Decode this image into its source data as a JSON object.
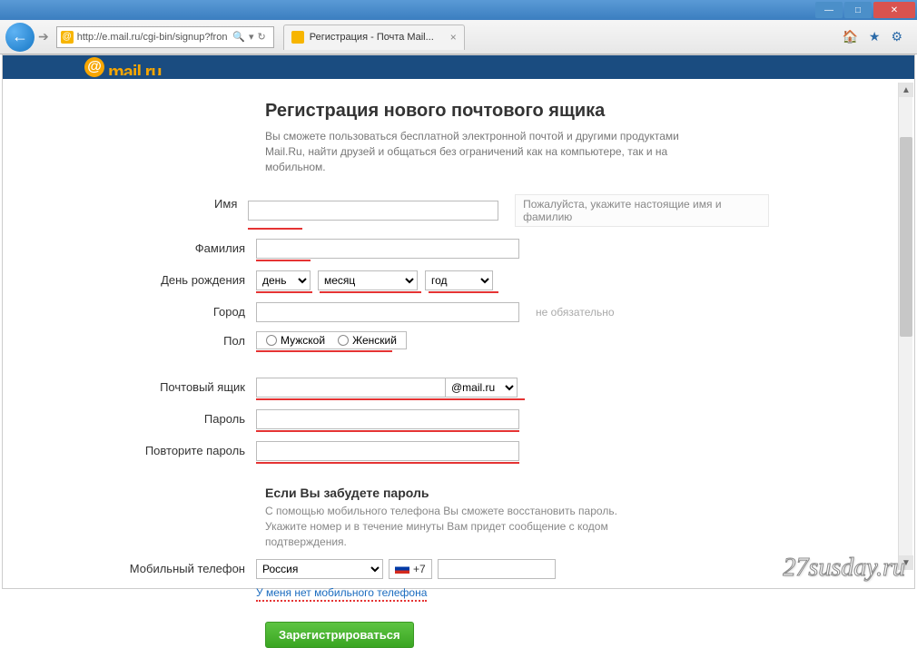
{
  "window": {
    "url": "http://e.mail.ru/cgi-bin/signup?fron",
    "tab_title": "Регистрация - Почта Mail..."
  },
  "page": {
    "logo_text": "mail.ru",
    "title": "Регистрация нового почтового ящика",
    "subtitle": "Вы сможете пользоваться бесплатной электронной почтой и другими продуктами Mail.Ru, найти друзей и общаться без ограничений как на компьютере, так и на мобильном."
  },
  "labels": {
    "firstname": "Имя",
    "lastname": "Фамилия",
    "birthday": "День рождения",
    "city": "Город",
    "gender": "Пол",
    "mailbox": "Почтовый ящик",
    "password": "Пароль",
    "password2": "Повторите пароль",
    "phone": "Мобильный телефон"
  },
  "hints": {
    "name": "Пожалуйста, укажите настоящие имя и фамилию",
    "city_optional": "не обязательно"
  },
  "birthday": {
    "day": "день",
    "month": "месяц",
    "year": "год"
  },
  "gender": {
    "male": "Мужской",
    "female": "Женский"
  },
  "mailbox": {
    "domain": "@mail.ru"
  },
  "recovery": {
    "heading": "Если Вы забудете пароль",
    "text": "С помощью мобильного телефона Вы сможете восстановить пароль. Укажите номер и в течение минуты Вам придет сообщение с кодом подтверждения."
  },
  "phone": {
    "country": "Россия",
    "prefix": "+7"
  },
  "links": {
    "no_phone": "У меня нет мобильного телефона"
  },
  "buttons": {
    "submit": "Зарегистрироваться"
  },
  "watermark": "27susday.ru"
}
